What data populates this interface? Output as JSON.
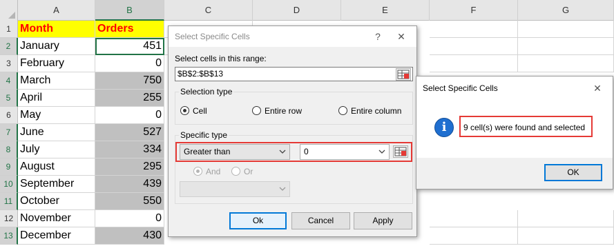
{
  "columns": [
    "A",
    "B",
    "C",
    "D",
    "E",
    "F",
    "G"
  ],
  "rows": [
    "1",
    "2",
    "3",
    "4",
    "5",
    "6",
    "7",
    "8",
    "9",
    "10",
    "11",
    "12",
    "13"
  ],
  "sheet": {
    "header": {
      "month": "Month",
      "orders": "Orders"
    },
    "data": [
      {
        "month": "January",
        "orders": "451"
      },
      {
        "month": "February",
        "orders": "0"
      },
      {
        "month": "March",
        "orders": "750"
      },
      {
        "month": "April",
        "orders": "255"
      },
      {
        "month": "May",
        "orders": "0"
      },
      {
        "month": "June",
        "orders": "527"
      },
      {
        "month": "July",
        "orders": "334"
      },
      {
        "month": "August",
        "orders": "295"
      },
      {
        "month": "September",
        "orders": "439"
      },
      {
        "month": "October",
        "orders": "550"
      },
      {
        "month": "November",
        "orders": "0"
      },
      {
        "month": "December",
        "orders": "430"
      }
    ],
    "colors": {
      "header_fill": "#ffff00",
      "header_text": "#ff0000",
      "selected_fill": "#c0c0c0",
      "active_border": "#217346"
    }
  },
  "dialog_main": {
    "title": "Select Specific Cells",
    "help_glyph": "?",
    "close_glyph": "✕",
    "range_label": "Select cells in this range:",
    "range_value": "$B$2:$B$13",
    "selection_type": {
      "title": "Selection type",
      "options": [
        "Cell",
        "Entire row",
        "Entire column"
      ],
      "selected": "Cell"
    },
    "specific_type": {
      "title": "Specific type",
      "condition": "Greater than",
      "value": "0",
      "and_label": "And",
      "or_label": "Or",
      "logic_selected": "And"
    },
    "buttons": {
      "ok": "Ok",
      "cancel": "Cancel",
      "apply": "Apply"
    }
  },
  "dialog_result": {
    "title": "Select Specific Cells",
    "close_glyph": "✕",
    "info_glyph": "i",
    "message": "9 cell(s) were found and selected",
    "ok": "OK"
  }
}
